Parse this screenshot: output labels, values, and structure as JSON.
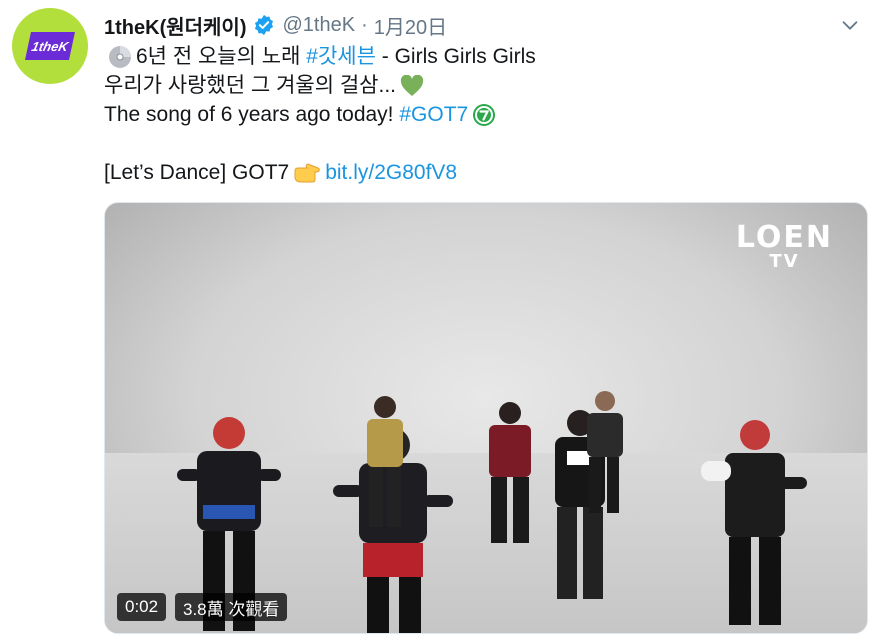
{
  "tweet": {
    "display_name": "1theK(원더케이)",
    "handle": "@1theK",
    "separator": "·",
    "date": "1月20日",
    "avatar_text": "1theK",
    "lines": {
      "l1_pre": "6년 전 오늘의 노래",
      "l1_hashtag": "#갓세븐",
      "l1_post": "- Girls Girls Girls",
      "l2": "우리가 사랑했던 그 겨울의 걸삼...",
      "l3_pre": "The song of 6 years ago today!",
      "l3_hashtag": "#GOT7",
      "l4_pre": "[Let’s Dance] GOT7",
      "l4_link": "bit.ly/2G80fV8"
    }
  },
  "media": {
    "logo_top": "LOEN",
    "logo_bottom": "TV",
    "time": "0:02",
    "views": "3.8萬 次觀看"
  },
  "colors": {
    "accent": "#1b95e0",
    "avatar_bg": "#b3df3d",
    "avatar_badge": "#6b2bd6"
  },
  "icons": [
    "disc-icon",
    "green-heart-icon",
    "got7-emoji-icon",
    "pointing-hand-icon",
    "verified-icon",
    "chevron-down-icon"
  ]
}
